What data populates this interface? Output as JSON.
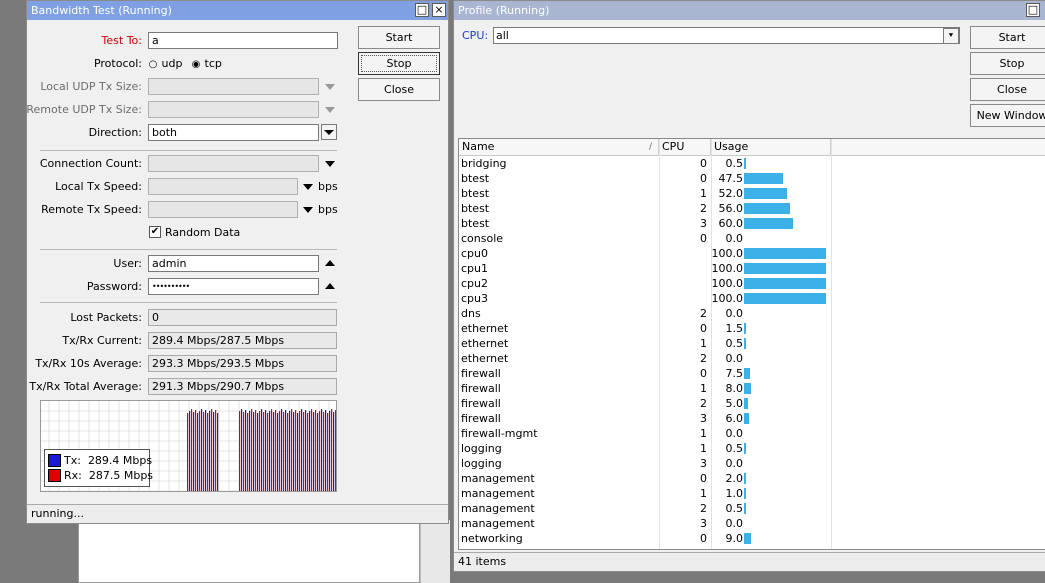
{
  "bandwidth": {
    "title": "Bandwidth Test (Running)",
    "win_btn_restore": "□",
    "win_btn_close": "×",
    "test_to": {
      "label": "Test To:",
      "value": "a"
    },
    "protocol": {
      "label": "Protocol:",
      "udp": "udp",
      "tcp": "tcp",
      "unselected_mark": "○",
      "selected_mark": "◉"
    },
    "local_udp_tx_size": {
      "label": "Local UDP Tx Size:"
    },
    "remote_udp_tx_size": {
      "label": "Remote UDP Tx Size:"
    },
    "direction": {
      "label": "Direction:",
      "value": "both"
    },
    "connection_count": {
      "label": "Connection Count:"
    },
    "local_tx_speed": {
      "label": "Local Tx Speed:",
      "unit": "bps"
    },
    "remote_tx_speed": {
      "label": "Remote Tx Speed:",
      "unit": "bps"
    },
    "random_data": {
      "label": "Random Data",
      "checked": true,
      "mark": "✔"
    },
    "user": {
      "label": "User:",
      "value": "admin"
    },
    "password": {
      "label": "Password:",
      "value": "••••••••••"
    },
    "lost_packets": {
      "label": "Lost Packets:",
      "value": "0"
    },
    "txrx_current": {
      "label": "Tx/Rx Current:",
      "value": "289.4 Mbps/287.5 Mbps"
    },
    "txrx_10s": {
      "label": "Tx/Rx 10s Average:",
      "value": "293.3 Mbps/293.5 Mbps"
    },
    "txrx_total": {
      "label": "Tx/Rx Total Average:",
      "value": "291.3 Mbps/290.7 Mbps"
    },
    "buttons": {
      "start": "Start",
      "stop": "Stop",
      "close": "Close"
    },
    "legend": {
      "tx_label": "Tx:",
      "tx_value": "289.4 Mbps",
      "tx_color": "#1a1ad6",
      "rx_label": "Rx:",
      "rx_value": "287.5 Mbps",
      "rx_color": "#e00000"
    },
    "status": "running..."
  },
  "profile": {
    "title": "Profile (Running)",
    "win_btn_restore": "□",
    "cpu": {
      "label": "CPU:",
      "value": "all",
      "dropdown_glyph": "⯆"
    },
    "buttons": {
      "start": "Start",
      "stop": "Stop",
      "close": "Close",
      "new_window": "New Window"
    },
    "columns": {
      "name": "Name",
      "cpu": "CPU",
      "usage": "Usage",
      "sort_glyph": "/"
    },
    "rows": [
      {
        "name": "bridging",
        "cpu": "0",
        "usage": "0.5"
      },
      {
        "name": "btest",
        "cpu": "0",
        "usage": "47.5"
      },
      {
        "name": "btest",
        "cpu": "1",
        "usage": "52.0"
      },
      {
        "name": "btest",
        "cpu": "2",
        "usage": "56.0"
      },
      {
        "name": "btest",
        "cpu": "3",
        "usage": "60.0"
      },
      {
        "name": "console",
        "cpu": "0",
        "usage": "0.0"
      },
      {
        "name": "cpu0",
        "cpu": "",
        "usage": "100.0"
      },
      {
        "name": "cpu1",
        "cpu": "",
        "usage": "100.0"
      },
      {
        "name": "cpu2",
        "cpu": "",
        "usage": "100.0"
      },
      {
        "name": "cpu3",
        "cpu": "",
        "usage": "100.0"
      },
      {
        "name": "dns",
        "cpu": "2",
        "usage": "0.0"
      },
      {
        "name": "ethernet",
        "cpu": "0",
        "usage": "1.5"
      },
      {
        "name": "ethernet",
        "cpu": "1",
        "usage": "0.5"
      },
      {
        "name": "ethernet",
        "cpu": "2",
        "usage": "0.0"
      },
      {
        "name": "firewall",
        "cpu": "0",
        "usage": "7.5"
      },
      {
        "name": "firewall",
        "cpu": "1",
        "usage": "8.0"
      },
      {
        "name": "firewall",
        "cpu": "2",
        "usage": "5.0"
      },
      {
        "name": "firewall",
        "cpu": "3",
        "usage": "6.0"
      },
      {
        "name": "firewall-mgmt",
        "cpu": "1",
        "usage": "0.0"
      },
      {
        "name": "logging",
        "cpu": "1",
        "usage": "0.5"
      },
      {
        "name": "logging",
        "cpu": "3",
        "usage": "0.0"
      },
      {
        "name": "management",
        "cpu": "0",
        "usage": "2.0"
      },
      {
        "name": "management",
        "cpu": "1",
        "usage": "1.0"
      },
      {
        "name": "management",
        "cpu": "2",
        "usage": "0.5"
      },
      {
        "name": "management",
        "cpu": "3",
        "usage": "0.0"
      },
      {
        "name": "networking",
        "cpu": "0",
        "usage": "9.0"
      }
    ],
    "usage_bar_color": "#3cb1e8",
    "status": "41 items"
  }
}
